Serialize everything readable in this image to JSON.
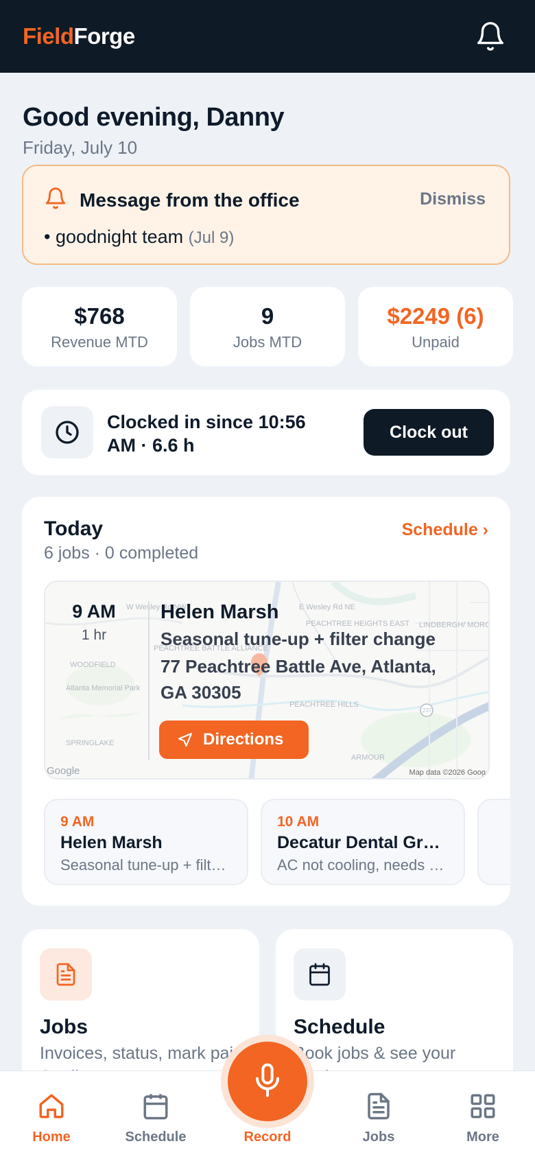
{
  "app": {
    "logo_part1": "Field",
    "logo_part2": "Forge",
    "accent": "#f26522",
    "dark": "#0e1a26"
  },
  "greeting": {
    "title": "Good evening, Danny",
    "date": "Friday, July 10"
  },
  "message": {
    "title": "Message from the office",
    "dismiss": "Dismiss",
    "bullet": "•",
    "text": "goodnight team",
    "date": "(Jul 9)"
  },
  "stats": [
    {
      "value": "$768",
      "label": "Revenue MTD"
    },
    {
      "value": "9",
      "label": "Jobs MTD"
    },
    {
      "value": "$2249 (6)",
      "label": "Unpaid"
    }
  ],
  "clock": {
    "status": "Clocked in since 10:56 AM · 6.6 h",
    "button": "Clock out"
  },
  "today": {
    "title": "Today",
    "summary": "6 jobs · 0 completed",
    "schedule_link": "Schedule ›",
    "next_job": {
      "time": "9 AM",
      "duration": "1 hr",
      "customer": "Helen Marsh",
      "service": "Seasonal tune-up + filter change",
      "address": "77 Peachtree Battle Ave, Atlanta, GA 30305",
      "directions": "Directions"
    },
    "map": {
      "labels": [
        "W Wesley Rd NW",
        "E Wesley Rd NE",
        "PEACHTREE HEIGHTS EAST",
        "LINDBERGH/ MOROSGO",
        "PEACHTREE BATTLE ALLIANCE",
        "WOODFIELD",
        "Atlanta Memorial Park",
        "PEACHTREE HILLS",
        "SPRINGLAKE",
        "ARMOUR",
        "237"
      ],
      "credit": "Map data ©2026 Goog",
      "logo": "Google"
    },
    "jobs": [
      {
        "time": "9 AM",
        "name": "Helen Marsh",
        "service": "Seasonal tune-up + filter change"
      },
      {
        "time": "10 AM",
        "name": "Decatur Dental Group",
        "service": "AC not cooling, needs diagnosis"
      }
    ]
  },
  "tiles": [
    {
      "title": "Jobs",
      "desc": "Invoices, status, mark paid & edit"
    },
    {
      "title": "Schedule",
      "desc": "Book jobs & see your week"
    }
  ],
  "nav": {
    "home": "Home",
    "schedule": "Schedule",
    "record": "Record",
    "jobs": "Jobs",
    "more": "More"
  }
}
